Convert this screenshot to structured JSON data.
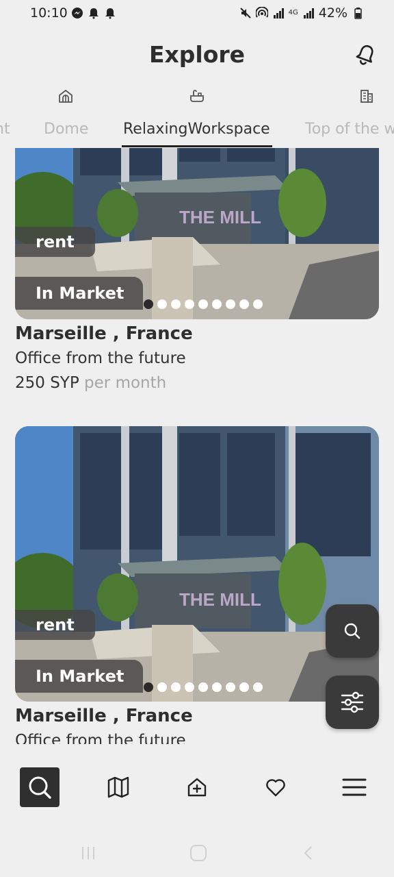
{
  "status_bar": {
    "time": "10:10",
    "battery": "42%",
    "network": "4G"
  },
  "header": {
    "title": "Explore"
  },
  "tabs": [
    {
      "label": "nt",
      "icon": "partial-icon"
    },
    {
      "label": "Dome",
      "icon": "dome-house-icon"
    },
    {
      "label": "RelaxingWorkspace",
      "icon": "bathtub-icon",
      "active": true
    },
    {
      "label": "Top of the w",
      "icon": "building-icon"
    }
  ],
  "listings": [
    {
      "badge_type": "rent",
      "badge_status": "In Market",
      "location": "Marseille , France",
      "description": "Office from the future",
      "price": "250 SYP",
      "period": "per month",
      "images_count": 9
    },
    {
      "badge_type": "rent",
      "badge_status": "In Market",
      "location": "Marseille , France",
      "description": "Office from the future",
      "images_count": 9
    }
  ],
  "bottom_nav": [
    {
      "name": "search",
      "icon": "search-icon",
      "active": true
    },
    {
      "name": "map",
      "icon": "map-icon"
    },
    {
      "name": "add",
      "icon": "add-home-icon"
    },
    {
      "name": "favorites",
      "icon": "heart-icon"
    },
    {
      "name": "menu",
      "icon": "menu-icon"
    }
  ],
  "colors": {
    "background": "#efeff0",
    "dark": "#2f2f2f",
    "muted": "#b9b9b9"
  }
}
